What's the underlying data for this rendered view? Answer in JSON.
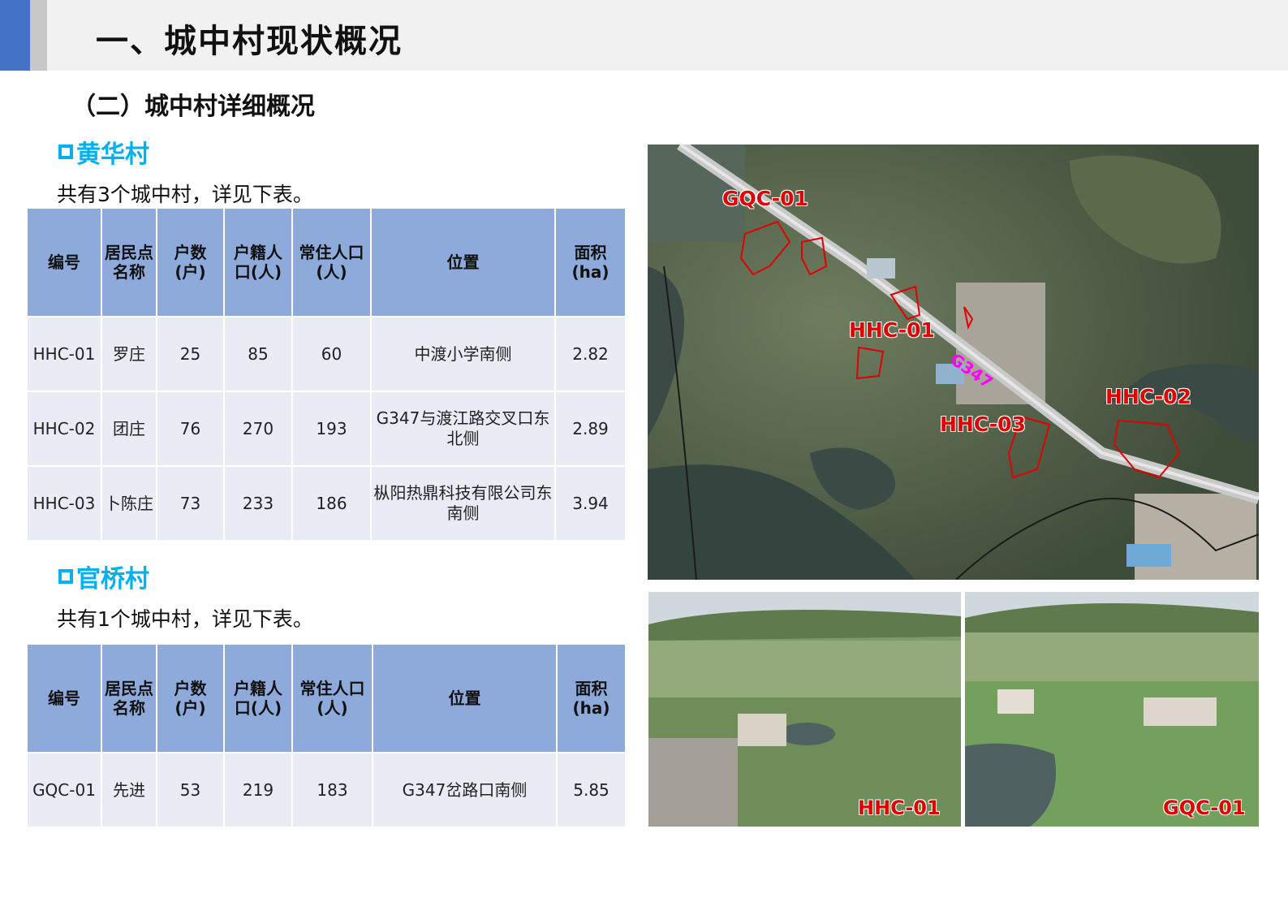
{
  "header": {
    "title": "一、城中村现状概况"
  },
  "section": {
    "subtitle": "（二）城中村详细概况"
  },
  "tables": {
    "columns": [
      "编号",
      "居民点名称",
      "户数(户)",
      "户籍人口(人)",
      "常住人口(人)",
      "位置",
      "面积(ha)"
    ],
    "huanghua": {
      "heading": "黄华村",
      "summary": "共有3个城中村，详见下表。",
      "rows": [
        {
          "id": "HHC-01",
          "name": "罗庄",
          "households": "25",
          "registered": "85",
          "resident": "60",
          "location": "中渡小学南侧",
          "area": "2.82"
        },
        {
          "id": "HHC-02",
          "name": "团庄",
          "households": "76",
          "registered": "270",
          "resident": "193",
          "location": "G347与渡江路交叉口东北侧",
          "area": "2.89"
        },
        {
          "id": "HHC-03",
          "name": "卜陈庄",
          "households": "73",
          "registered": "233",
          "resident": "186",
          "location": "枞阳热鼎科技有限公司东南侧",
          "area": "3.94"
        }
      ]
    },
    "guanqiao": {
      "heading": "官桥村",
      "summary": "共有1个城中村，详见下表。",
      "rows": [
        {
          "id": "GQC-01",
          "name": "先进",
          "households": "53",
          "registered": "219",
          "resident": "183",
          "location": "G347岔路口南侧",
          "area": "5.85"
        }
      ]
    }
  },
  "map": {
    "labels": {
      "gqc01": "GQC-01",
      "hhc01": "HHC-01",
      "hhc02": "HHC-02",
      "hhc03": "HHC-03",
      "road": "G347"
    },
    "colors": {
      "boundary": "#e00000",
      "road_label": "#ff00ff"
    }
  },
  "photos": {
    "left_label": "HHC-01",
    "right_label": "GQC-01"
  },
  "colors": {
    "accent": "#00b0f0",
    "table_header": "#8eaadb",
    "table_cell": "#e9ebf5"
  }
}
